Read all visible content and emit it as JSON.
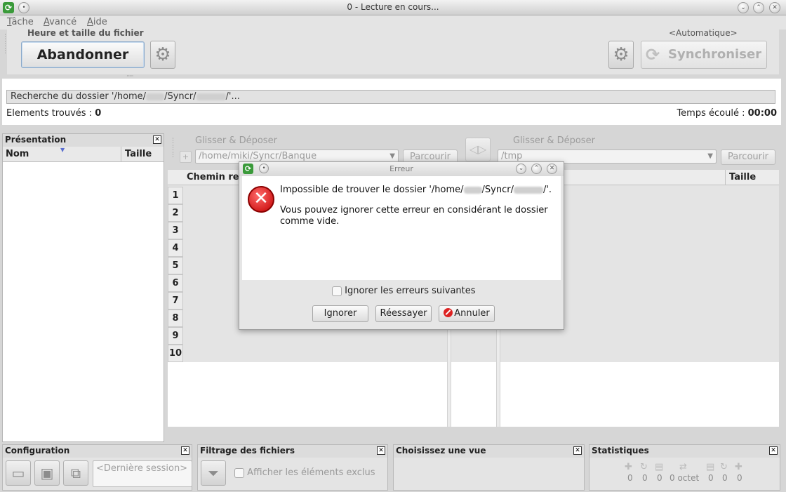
{
  "window": {
    "title": "0 - Lecture en cours..."
  },
  "menu": {
    "items": [
      "Tâche",
      "Avancé",
      "Aide"
    ]
  },
  "toolbar": {
    "left_label": "Heure et taille du fichier",
    "abandon_label": "Abandonner",
    "right_label": "<Automatique>",
    "sync_label": "Synchroniser"
  },
  "status": {
    "search_prefix": "Recherche du dossier '/home/",
    "search_mid": "/Syncr/",
    "search_suffix": "/'...",
    "found_label": "Elements trouvés :",
    "found_value": "0",
    "elapsed_label": "Temps écoulé :",
    "elapsed_value": "00:00"
  },
  "left_panel": {
    "title": "Présentation",
    "col_name": "Nom",
    "col_size": "Taille"
  },
  "left_folder": {
    "drag_label": "Glisser & Déposer",
    "path": "/home/miki/Syncr/Banque",
    "browse_label": "Parcourir"
  },
  "right_folder": {
    "drag_label": "Glisser & Déposer",
    "path": "/tmp",
    "browse_label": "Parcourir"
  },
  "grid": {
    "col_path": "Chemin relatif",
    "col_size": "Taille",
    "rows": [
      "1",
      "2",
      "3",
      "4",
      "5",
      "6",
      "7",
      "8",
      "9",
      "10"
    ]
  },
  "bottom": {
    "config_title": "Configuration",
    "session_placeholder": "<Dernière session>",
    "filter_title": "Filtrage des fichiers",
    "show_excluded": "Afficher les éléments exclus",
    "view_title": "Choisissez une vue",
    "stats_title": "Statistiques",
    "stats_values": [
      "0",
      "0",
      "0",
      "0 octet",
      "0",
      "0",
      "0"
    ]
  },
  "dialog": {
    "title": "Erreur",
    "message_prefix": "Impossible de trouver le dossier '/home/",
    "message_mid": "/Syncr/",
    "message_suffix": "/'.",
    "message_detail": "Vous pouvez ignorer cette erreur en considérant le dossier comme vide.",
    "checkbox_label": "Ignorer les erreurs suivantes",
    "ignore_label": "Ignorer",
    "retry_label": "Réessayer",
    "cancel_label": "Annuler"
  },
  "colors": {
    "error_red": "#c30000",
    "accent_blue": "#8aa8c9"
  }
}
